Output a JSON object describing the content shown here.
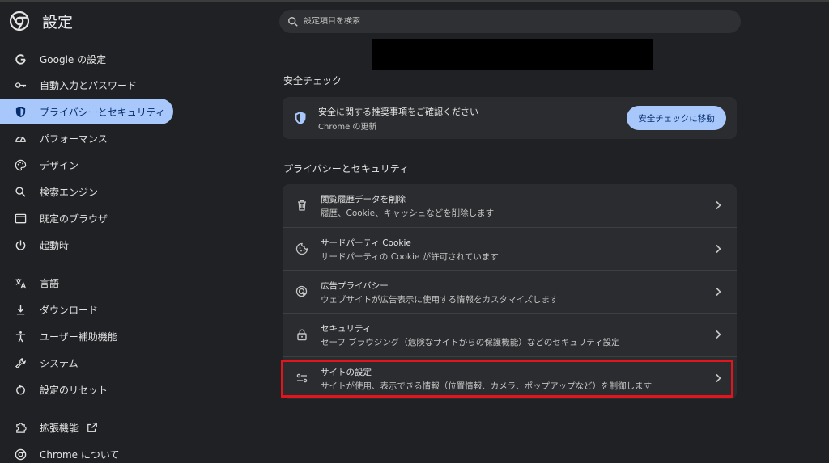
{
  "app": {
    "title": "設定"
  },
  "search": {
    "placeholder": "設定項目を検索"
  },
  "sidebar": {
    "items": [
      {
        "label": "Google の設定",
        "icon": "google-g-icon"
      },
      {
        "label": "自動入力とパスワード",
        "icon": "key-icon"
      },
      {
        "label": "プライバシーとセキュリティ",
        "icon": "shield-icon",
        "active": true
      },
      {
        "label": "パフォーマンス",
        "icon": "speedometer-icon"
      },
      {
        "label": "デザイン",
        "icon": "palette-icon"
      },
      {
        "label": "検索エンジン",
        "icon": "search-icon"
      },
      {
        "label": "既定のブラウザ",
        "icon": "browser-window-icon"
      },
      {
        "label": "起動時",
        "icon": "power-icon"
      },
      {
        "label": "言語",
        "icon": "translate-icon"
      },
      {
        "label": "ダウンロード",
        "icon": "download-icon"
      },
      {
        "label": "ユーザー補助機能",
        "icon": "accessibility-icon"
      },
      {
        "label": "システム",
        "icon": "wrench-icon"
      },
      {
        "label": "設定のリセット",
        "icon": "reset-icon"
      },
      {
        "label": "拡張機能",
        "icon": "puzzle-icon"
      },
      {
        "label": "Chrome について",
        "icon": "chrome-icon"
      }
    ]
  },
  "safety_check": {
    "heading": "安全チェック",
    "title": "安全に関する推奨事項をご確認ください",
    "subtitle": "Chrome の更新",
    "button": "安全チェックに移動"
  },
  "privacy": {
    "heading": "プライバシーとセキュリティ",
    "rows": [
      {
        "title": "閲覧履歴データを削除",
        "subtitle": "履歴、Cookie、キャッシュなどを削除します",
        "icon": "trash-icon"
      },
      {
        "title": "サードパーティ Cookie",
        "subtitle": "サードパーティの Cookie が許可されています",
        "icon": "cookie-icon"
      },
      {
        "title": "広告プライバシー",
        "subtitle": "ウェブサイトが広告表示に使用する情報をカスタマイズします",
        "icon": "ad-privacy-icon"
      },
      {
        "title": "セキュリティ",
        "subtitle": "セーフ ブラウジング（危険なサイトからの保護機能）などのセキュリティ設定",
        "icon": "lock-icon"
      },
      {
        "title": "サイトの設定",
        "subtitle": "サイトが使用、表示できる情報（位置情報、カメラ、ポップアップなど）を制御します",
        "icon": "sliders-icon"
      }
    ]
  },
  "colors": {
    "accent": "#a8c7fa",
    "highlight": "#e3141c",
    "background": "#202124",
    "card": "#2b2c2f"
  }
}
